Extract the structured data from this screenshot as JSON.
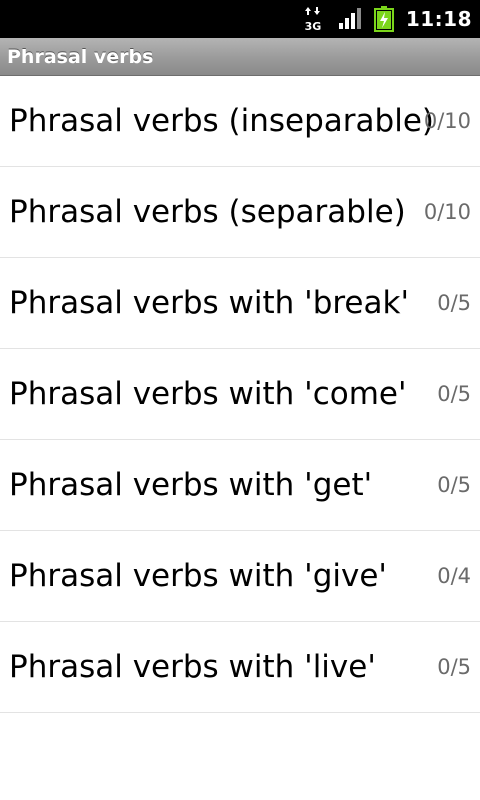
{
  "status_bar": {
    "network_label": "3G",
    "network_icon": "data-3g-icon",
    "signal_icon": "signal-strength-icon",
    "battery_icon": "battery-charging-icon",
    "time": "11:18"
  },
  "header": {
    "title": "Phrasal verbs"
  },
  "list": {
    "items": [
      {
        "label": "Phrasal verbs (inseparable)",
        "count": "0/10"
      },
      {
        "label": "Phrasal verbs (separable)",
        "count": "0/10"
      },
      {
        "label": "Phrasal verbs with 'break'",
        "count": "0/5"
      },
      {
        "label": "Phrasal verbs with 'come'",
        "count": "0/5"
      },
      {
        "label": "Phrasal verbs with 'get'",
        "count": "0/5"
      },
      {
        "label": "Phrasal verbs with 'give'",
        "count": "0/4"
      },
      {
        "label": "Phrasal verbs with 'live'",
        "count": "0/5"
      }
    ]
  },
  "colors": {
    "status_bar_bg": "#000000",
    "title_bar_bg": "#9a9a9a",
    "battery_green": "#7bd51b",
    "count_text": "#6a6a6a"
  }
}
